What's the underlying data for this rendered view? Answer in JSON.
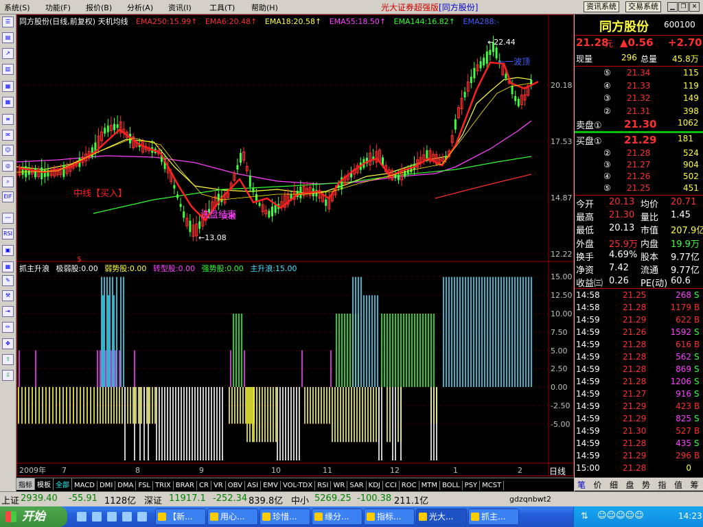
{
  "menu": {
    "items": [
      "系统(S)",
      "功能(F)",
      "报价(B)",
      "分析(A)",
      "资讯(I)",
      "工具(T)",
      "帮助(H)"
    ],
    "app_title": "光大证券超强版",
    "app_stock": "[同方股份]",
    "sys_buttons": [
      "资讯系统",
      "交易系统"
    ]
  },
  "chart": {
    "title": "同方股份(日线,前复权) 天机均线",
    "ema_labels": [
      {
        "text": "EMA250:15.99↑",
        "color": "#ff3030"
      },
      {
        "text": "EMA6:20.48↑",
        "color": "#ff3030"
      },
      {
        "text": "EMA18:20.58↑",
        "color": "#ffff40"
      },
      {
        "text": "EMA55:18.50↑",
        "color": "#ff40ff"
      },
      {
        "text": "EMA144:16.82↑",
        "color": "#30ff30"
      },
      {
        "text": "EMA288:-",
        "color": "#4060ff"
      }
    ],
    "price_ticks": [
      "20.18",
      "17.53",
      "14.87",
      "12.22"
    ],
    "annotations": {
      "buy": "中线【买入】",
      "high": "22.44",
      "low": "13.08",
      "top": "一波顶",
      "wash": "洗盘结束",
      "break": "突破"
    },
    "indicator_labels": [
      {
        "text": "抓主升浪",
        "color": "#ffffff"
      },
      {
        "text": "极弱股:0.00",
        "color": "#ffffff"
      },
      {
        "text": "弱势股:0.00",
        "color": "#ffff40"
      },
      {
        "text": "转型股:0.00",
        "color": "#ff40ff"
      },
      {
        "text": "强势股:0.00",
        "color": "#30ff30"
      },
      {
        "text": "主升浪:15.00",
        "color": "#40e0ff"
      }
    ],
    "ind_ticks": [
      "15.00",
      "12.50",
      "10.00",
      "7.50",
      "5.00",
      "2.50",
      "0.00",
      "-2.50",
      "-5.00"
    ],
    "date_labels": [
      "2009年",
      "7",
      "8",
      "9",
      "10",
      "11",
      "12",
      "1",
      "2"
    ],
    "period": "日线",
    "tabs": [
      "指标",
      "模板",
      "全部",
      "MACD",
      "DMI",
      "DMA",
      "FSL",
      "TRIX",
      "BRAR",
      "CR",
      "VR",
      "OBV",
      "ASI",
      "EMV",
      "VOL-TDX",
      "RSI",
      "WR",
      "SAR",
      "KDJ",
      "CCI",
      "ROC",
      "MTM",
      "BOLL",
      "PSY",
      "MCST"
    ]
  },
  "quote": {
    "name": "同方股份",
    "code": "600100",
    "price": "21.28",
    "unit": "元",
    "change": "▲0.56",
    "pct": "+2.70",
    "xianliang_label": "现量",
    "xianliang": "296",
    "zongliang_label": "总量",
    "zongliang": "45.8万",
    "sell": [
      {
        "n": "⑤",
        "p": "21.34",
        "v": "115"
      },
      {
        "n": "④",
        "p": "21.33",
        "v": "119"
      },
      {
        "n": "③",
        "p": "21.32",
        "v": "149"
      },
      {
        "n": "②",
        "p": "21.31",
        "v": "398"
      }
    ],
    "sell1": {
      "label": "卖盘①",
      "p": "21.30",
      "v": "1062"
    },
    "buy1": {
      "label": "买盘①",
      "p": "21.29",
      "v": "181"
    },
    "buy": [
      {
        "n": "②",
        "p": "21.28",
        "v": "524"
      },
      {
        "n": "③",
        "p": "21.27",
        "v": "904"
      },
      {
        "n": "④",
        "p": "21.26",
        "v": "502"
      },
      {
        "n": "⑤",
        "p": "21.25",
        "v": "451"
      }
    ],
    "stats": [
      [
        "今开",
        "20.13",
        "均价",
        "20.71"
      ],
      [
        "最高",
        "21.30",
        "量比",
        "1.45"
      ],
      [
        "最低",
        "20.13",
        "市值",
        "207.9亿"
      ],
      [
        "外盘",
        "25.9万",
        "内盘",
        "19.9万"
      ],
      [
        "换手",
        "4.69%",
        "股本",
        "9.77亿"
      ],
      [
        "净资",
        "7.42",
        "流通",
        "9.77亿"
      ],
      [
        "收益㈢",
        "0.26",
        "PE(动)",
        "60.6"
      ]
    ],
    "ticks": [
      [
        "14:58",
        "21.25",
        "268",
        "S"
      ],
      [
        "14:58",
        "21.28",
        "1179",
        "B"
      ],
      [
        "14:59",
        "21.29",
        "622",
        "B"
      ],
      [
        "14:59",
        "21.26",
        "1592",
        "S"
      ],
      [
        "14:59",
        "21.28",
        "616",
        "B"
      ],
      [
        "14:59",
        "21.28",
        "562",
        "S"
      ],
      [
        "14:59",
        "21.28",
        "869",
        "S"
      ],
      [
        "14:59",
        "21.28",
        "1206",
        "S"
      ],
      [
        "14:59",
        "21.27",
        "916",
        "S"
      ],
      [
        "14:59",
        "21.29",
        "423",
        "B"
      ],
      [
        "14:59",
        "21.29",
        "825",
        "S"
      ],
      [
        "14:59",
        "21.30",
        "527",
        "B"
      ],
      [
        "14:59",
        "21.28",
        "435",
        "S"
      ],
      [
        "14:59",
        "21.29",
        "296",
        "B"
      ],
      [
        "15:00",
        "21.28",
        "0",
        ""
      ]
    ],
    "bottom_tabs": [
      "笔",
      "价",
      "细",
      "盘",
      "势",
      "指",
      "值",
      "筹"
    ]
  },
  "status": {
    "sh_label": "上证",
    "sh": "2939.40",
    "sh_chg": "-55.91",
    "sh_amt": "1128亿",
    "sz_label": "深证",
    "sz": "11917.1",
    "sz_chg": "-252.34",
    "sz_amt": "839.8亿",
    "zx_label": "中小",
    "zx": "5269.25",
    "zx_chg": "-100.38",
    "zx_amt": "211.1亿",
    "marquee": "gdzqnbwt2"
  },
  "taskbar": {
    "start": "开始",
    "items": [
      "【新...",
      "用心...",
      "珍惜...",
      "缘分...",
      "指标...",
      "光大...",
      "抓主..."
    ],
    "clock": "14:23"
  }
}
